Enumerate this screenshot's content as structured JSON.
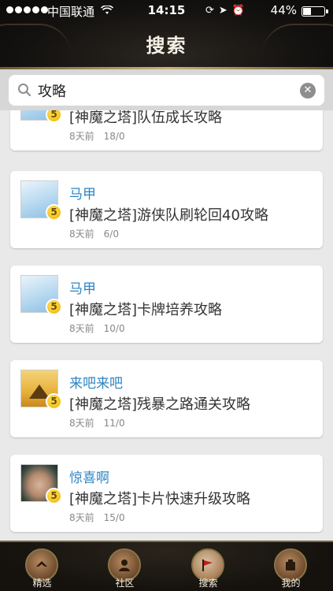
{
  "status_bar": {
    "carrier": "中国联通",
    "time": "14:15",
    "battery_percent": "44%",
    "battery_level": 0.44
  },
  "header": {
    "title": "搜索"
  },
  "search": {
    "value": "攻略",
    "placeholder": ""
  },
  "posts": [
    {
      "user": "",
      "title": "[神魔之塔]队伍成长攻略",
      "time": "8天前",
      "counts": "18/0",
      "avatar": "sky",
      "level": "5"
    },
    {
      "user": "马甲",
      "title": "[神魔之塔]游侠队刷轮回40攻略",
      "time": "8天前",
      "counts": "6/0",
      "avatar": "sky",
      "level": "5"
    },
    {
      "user": "马甲",
      "title": "[神魔之塔]卡牌培养攻略",
      "time": "8天前",
      "counts": "10/0",
      "avatar": "sky",
      "level": "5"
    },
    {
      "user": "来吧来吧",
      "title": "[神魔之塔]残暴之路通关攻略",
      "time": "8天前",
      "counts": "11/0",
      "avatar": "gold",
      "level": "5"
    },
    {
      "user": "惊喜啊",
      "title": "[神魔之塔]卡片快速升级攻略",
      "time": "8天前",
      "counts": "15/0",
      "avatar": "face",
      "level": "5"
    }
  ],
  "tabs": [
    {
      "label": "精选",
      "icon": "featured-icon"
    },
    {
      "label": "社区",
      "icon": "community-icon"
    },
    {
      "label": "搜索",
      "icon": "search-flag-icon",
      "active": true
    },
    {
      "label": "我的",
      "icon": "profile-icon"
    }
  ],
  "colors": {
    "username": "#2f86c3",
    "badge": "#f0b400",
    "header_bg": "#141210"
  }
}
